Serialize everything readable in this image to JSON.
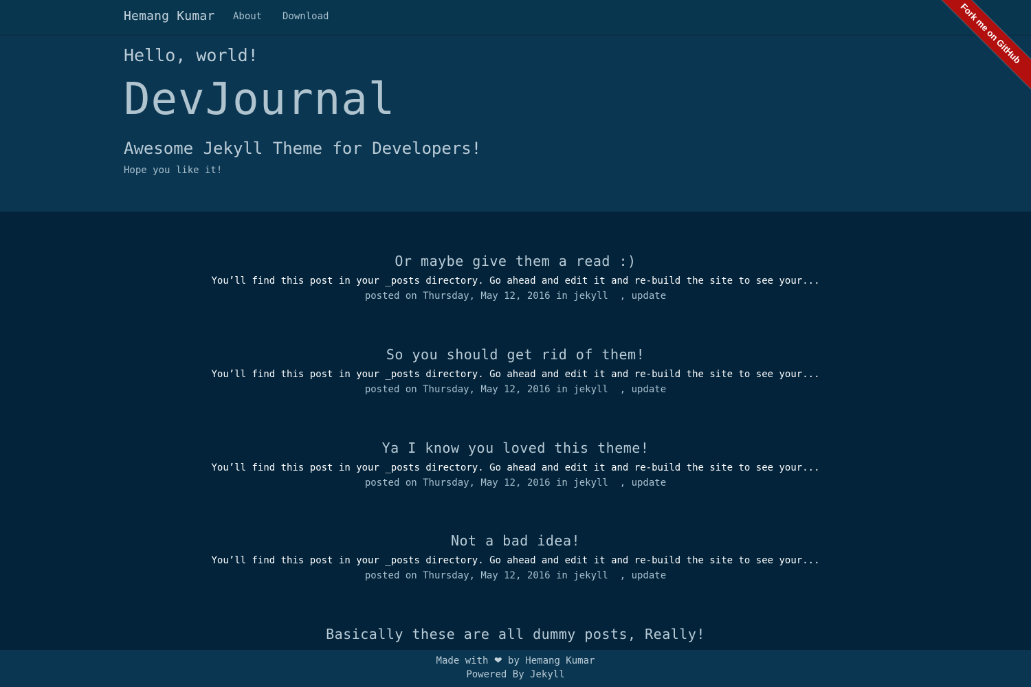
{
  "nav": {
    "brand": "Hemang Kumar",
    "links": [
      "About",
      "Download"
    ]
  },
  "ribbon": {
    "label": "Fork me on GitHub"
  },
  "hero": {
    "greeting": "Hello, world!",
    "title": "DevJournal",
    "subtitle": "Awesome Jekyll Theme for Developers!",
    "tagline": "Hope you like it!"
  },
  "posts": [
    {
      "title": "Or maybe give them a read :)",
      "excerpt": "You’ll find this post in your _posts directory. Go ahead and edit it and re-build the site to see your...",
      "meta_prefix": "posted on Thursday, May 12, 2016 in",
      "categories": [
        "jekyll",
        "update"
      ]
    },
    {
      "title": "So you should get rid of them!",
      "excerpt": "You’ll find this post in your _posts directory. Go ahead and edit it and re-build the site to see your...",
      "meta_prefix": "posted on Thursday, May 12, 2016 in",
      "categories": [
        "jekyll",
        "update"
      ]
    },
    {
      "title": "Ya I know you loved this theme!",
      "excerpt": "You’ll find this post in your _posts directory. Go ahead and edit it and re-build the site to see your...",
      "meta_prefix": "posted on Thursday, May 12, 2016 in",
      "categories": [
        "jekyll",
        "update"
      ]
    },
    {
      "title": "Not a bad idea!",
      "excerpt": "You’ll find this post in your _posts directory. Go ahead and edit it and re-build the site to see your...",
      "meta_prefix": "posted on Thursday, May 12, 2016 in",
      "categories": [
        "jekyll",
        "update"
      ]
    },
    {
      "title": "Basically these are all dummy posts, Really!"
    }
  ],
  "footer": {
    "made_with": "Made with",
    "heart_icon": "heart-icon",
    "by": "by Hemang Kumar",
    "powered": "Powered By Jekyll"
  },
  "colors": {
    "page_bg": "#02233a",
    "header_bg": "#0a3651",
    "ribbon": "#b20f0f"
  }
}
